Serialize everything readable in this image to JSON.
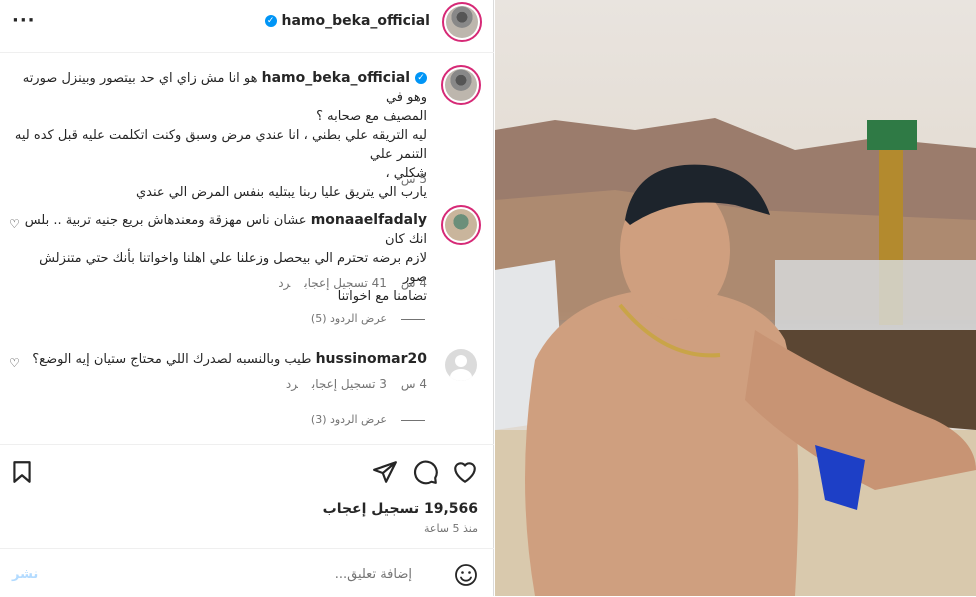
{
  "header": {
    "username": "hamo_beka_official",
    "more_label": "···"
  },
  "caption": {
    "username": "hamo_beka_official",
    "lines": [
      "هو انا مش زاي اي حد بيتصور وبينزل صورته وهو في",
      "المصيف مع صحابه ؟",
      "ليه التريقه علي بطني ، انا عندي مرض وسبق وكنت اتكلمت عليه قبل كده ليه التنمر علي",
      "شكلي ،",
      "يارب الي يتريق عليا ربنا يبتليه بنفس المرض الي عندي"
    ],
    "time": "5 س"
  },
  "comments": [
    {
      "username": "monaaelfadaly",
      "lines": [
        "عشان ناس مهزقة ومعندهاش بريع جنيه تربية .. بلس انك كان",
        "لازم برضه تحترم الي بيحصل وزعلنا علي اهلنا واخواتنا بأنك حتي متنزلش صور",
        "تضامنا مع اخواتنا"
      ],
      "time": "4 س",
      "likes": "41 تسجيل إعجاب",
      "reply": "رد",
      "view_replies": "عرض الردود (5)"
    },
    {
      "username": "hussinomar20",
      "lines": [
        "طيب وبالنسبه لصدرك اللي محتاج ستيان إيه الوضع؟"
      ],
      "time": "4 س",
      "likes": "3 تسجيل إعجاب",
      "reply": "رد",
      "view_replies": "عرض الردود (3)"
    }
  ],
  "post": {
    "likes": "19,566 تسجيل إعجاب",
    "time": "منذ 5 ساعة"
  },
  "composer": {
    "placeholder": "إضافة تعليق...",
    "post_label": "نشر"
  },
  "colors": {
    "accent": "#0095f6",
    "muted": "#737373",
    "post_disabled": "#b3dbff"
  }
}
